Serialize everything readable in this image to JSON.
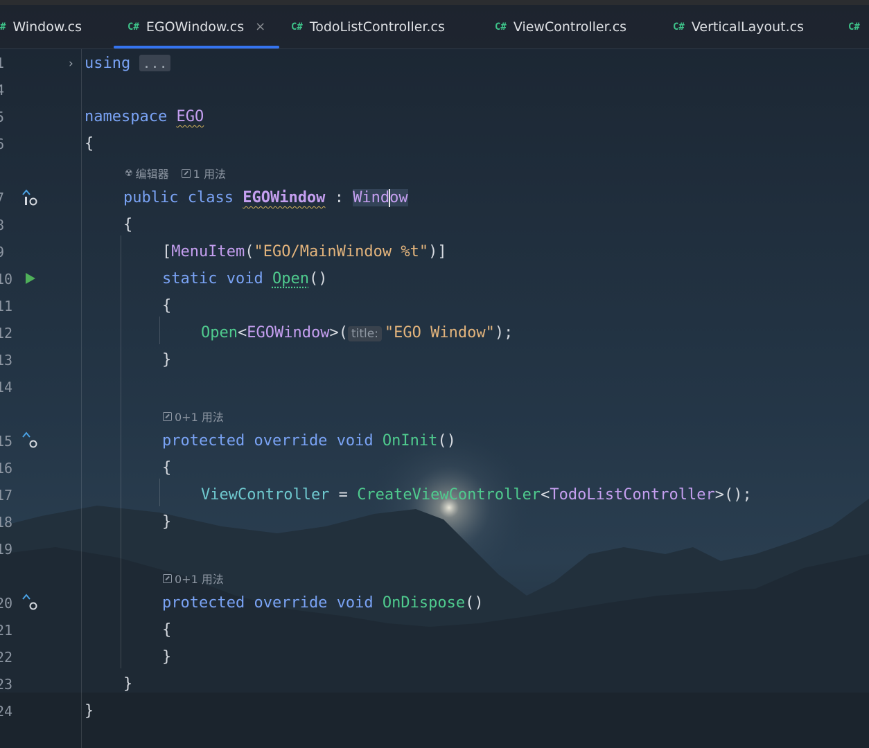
{
  "tabs": [
    {
      "icon": "#",
      "label": "Window.cs",
      "active": false
    },
    {
      "icon": "C#",
      "label": "EGOWindow.cs",
      "active": true,
      "close": "×"
    },
    {
      "icon": "C#",
      "label": "TodoListController.cs",
      "active": false
    },
    {
      "icon": "C#",
      "label": "ViewController.cs",
      "active": false
    },
    {
      "icon": "C#",
      "label": "VerticalLayout.cs",
      "active": false
    },
    {
      "icon": "C#",
      "label": "",
      "active": false
    }
  ],
  "line_numbers": [
    "1",
    "4",
    "5",
    "6",
    "7",
    "8",
    "9",
    "10",
    "11",
    "12",
    "13",
    "14",
    "15",
    "16",
    "17",
    "18",
    "19",
    "20",
    "21",
    "22",
    "23",
    "24"
  ],
  "code": {
    "l1_kw": "using",
    "l1_fold": "...",
    "l5_kw": "namespace",
    "l5_name": "EGO",
    "l6": "{",
    "l7_kw1": "public",
    "l7_kw2": "class",
    "l7_cls": "EGOWindow",
    "l7_colon": ":",
    "l7_base_a": "Wind",
    "l7_base_b": "ow",
    "l8": "{",
    "l9_open": "[",
    "l9_attr": "MenuItem",
    "l9_paren": "(",
    "l9_str": "\"EGO/MainWindow %t\"",
    "l9_close": ")]",
    "l10_kw1": "static",
    "l10_kw2": "void",
    "l10_m": "Open",
    "l10_p": "()",
    "l11": "{",
    "l12_m": "Open",
    "l12_lt": "<",
    "l12_cls": "EGOWindow",
    "l12_gt": ">(",
    "l12_hint": "title:",
    "l12_str": "\"EGO Window\"",
    "l12_end": ");",
    "l13": "}",
    "l15_kw1": "protected",
    "l15_kw2": "override",
    "l15_kw3": "void",
    "l15_m": "OnInit",
    "l15_p": "()",
    "l16": "{",
    "l17_prop": "ViewController",
    "l17_eq": " = ",
    "l17_m": "CreateViewController",
    "l17_lt": "<",
    "l17_cls": "TodoListController",
    "l17_end": ">();",
    "l18": "}",
    "l20_kw1": "protected",
    "l20_kw2": "override",
    "l20_kw3": "void",
    "l20_m": "OnDispose",
    "l20_p": "()",
    "l21": "{",
    "l22": "}",
    "l23": "}",
    "l24": "}"
  },
  "lenses": {
    "editor_label": "编辑器",
    "class_usages": "1 用法",
    "oninit_usages": "0+1 用法",
    "ondispose_usages": "0+1 用法"
  },
  "colors": {
    "keyword": "#7aa3f5",
    "class": "#c59ff0",
    "method": "#4fcb8e",
    "string": "#e3b47c",
    "accent": "#3574f0"
  }
}
